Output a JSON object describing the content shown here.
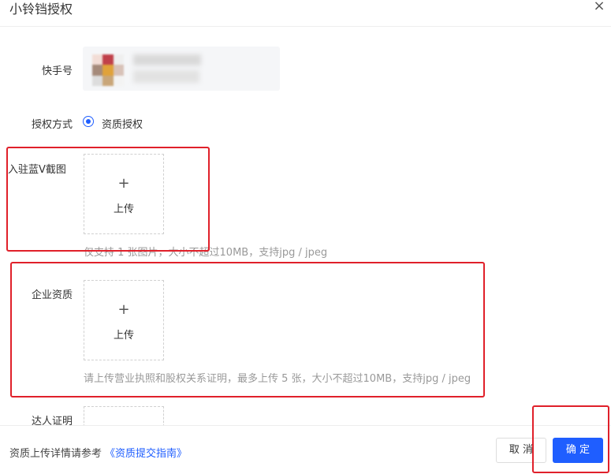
{
  "dialog": {
    "title": "小铃铛授权",
    "close_icon": "×"
  },
  "form": {
    "account": {
      "label": "快手号"
    },
    "auth_method": {
      "label": "授权方式",
      "option": "资质授权",
      "selected": true
    },
    "blue_v": {
      "label": "入驻蓝V截图",
      "upload_plus": "+",
      "upload_text": "上传",
      "hint": "仅支持 1 张图片，大小不超过10MB，支持jpg / jpeg"
    },
    "company": {
      "label": "企业资质",
      "upload_plus": "+",
      "upload_text": "上传",
      "hint": "请上传营业执照和股权关系证明，最多上传 5 张，大小不超过10MB，支持jpg / jpeg"
    },
    "talent": {
      "label": "达人证明"
    }
  },
  "footer": {
    "note": "资质上传详情请参考",
    "guide_link": "《资质提交指南》",
    "cancel_label": "取 消",
    "confirm_label": "确 定"
  },
  "colors": {
    "accent": "#1f5eff",
    "annotation_red": "#e0202a"
  }
}
